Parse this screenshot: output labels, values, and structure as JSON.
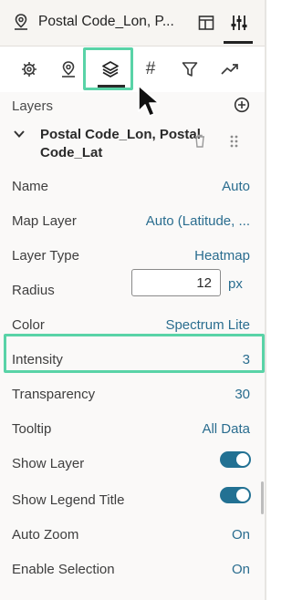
{
  "header": {
    "title": "Postal Code_Lon, P...",
    "icons": [
      "map-pin-icon",
      "layout-icon",
      "sliders-icon"
    ]
  },
  "tabs": [
    {
      "name": "settings-icon",
      "label": ""
    },
    {
      "name": "map-pin-icon",
      "label": ""
    },
    {
      "name": "layers-icon",
      "label": "",
      "active": true
    },
    {
      "name": "number-format",
      "label": "#"
    },
    {
      "name": "filter-icon",
      "label": ""
    },
    {
      "name": "trend-icon",
      "label": ""
    }
  ],
  "layers_section": {
    "label": "Layers",
    "layer_name": "Postal Code_Lon, Postal Code_Lat"
  },
  "properties": {
    "name": {
      "label": "Name",
      "value": "Auto"
    },
    "map_layer": {
      "label": "Map Layer",
      "value": "Auto (Latitude, ..."
    },
    "layer_type": {
      "label": "Layer Type",
      "value": "Heatmap"
    },
    "radius": {
      "label": "Radius",
      "value": "12",
      "unit": "px"
    },
    "color": {
      "label": "Color",
      "value": "Spectrum Lite"
    },
    "intensity": {
      "label": "Intensity",
      "value": "3"
    },
    "transparency": {
      "label": "Transparency",
      "value": "30"
    },
    "tooltip": {
      "label": "Tooltip",
      "value": "All Data"
    },
    "show_layer": {
      "label": "Show Layer",
      "on": true
    },
    "show_legend_title": {
      "label": "Show Legend Title",
      "on": true
    },
    "auto_zoom": {
      "label": "Auto Zoom",
      "value": "On"
    },
    "enable_selection": {
      "label": "Enable Selection",
      "value": "On"
    }
  },
  "colors": {
    "highlight": "#59d3a7",
    "link": "#2a6d8f",
    "toggle": "#227193"
  }
}
